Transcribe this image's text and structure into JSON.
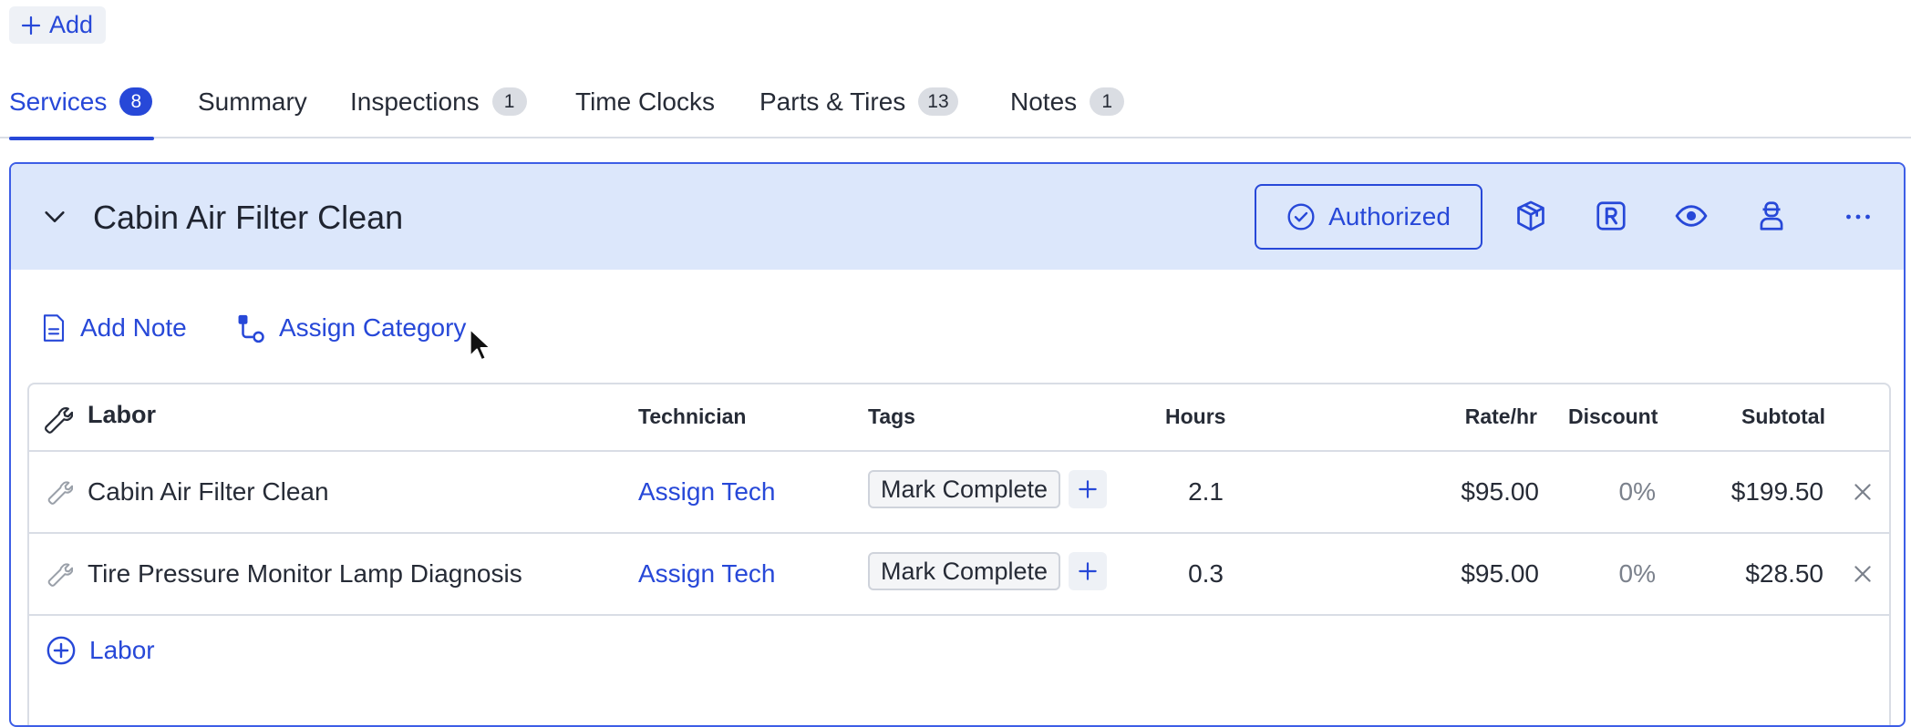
{
  "toolbar": {
    "add_label": "Add"
  },
  "tabs": [
    {
      "label": "Services",
      "badge": "8",
      "active": true
    },
    {
      "label": "Summary",
      "badge": null
    },
    {
      "label": "Inspections",
      "badge": "1"
    },
    {
      "label": "Time Clocks",
      "badge": null
    },
    {
      "label": "Parts & Tires",
      "badge": "13"
    },
    {
      "label": "Notes",
      "badge": "1"
    }
  ],
  "service": {
    "title": "Cabin Air Filter Clean",
    "status_label": "Authorized",
    "header_icons": [
      "package-icon",
      "r-badge-icon",
      "eye-icon",
      "technician-icon",
      "more-icon"
    ]
  },
  "actions": {
    "add_note": "Add Note",
    "assign_category": "Assign Category"
  },
  "labor_table": {
    "title": "Labor",
    "columns": {
      "technician": "Technician",
      "tags": "Tags",
      "hours": "Hours",
      "rate": "Rate/hr",
      "discount": "Discount",
      "subtotal": "Subtotal"
    },
    "rows": [
      {
        "name": "Cabin Air Filter Clean",
        "technician": "Assign Tech",
        "tag": "Mark Complete",
        "hours": "2.1",
        "rate": "$95.00",
        "discount": "0%",
        "subtotal": "$199.50"
      },
      {
        "name": "Tire Pressure Monitor Lamp Diagnosis",
        "technician": "Assign Tech",
        "tag": "Mark Complete",
        "hours": "0.3",
        "rate": "$95.00",
        "discount": "0%",
        "subtotal": "$28.50"
      }
    ],
    "add_label": "Labor"
  },
  "colors": {
    "accent": "#2748d8",
    "header_bg": "#dce7fb",
    "border": "#d9dde5"
  }
}
